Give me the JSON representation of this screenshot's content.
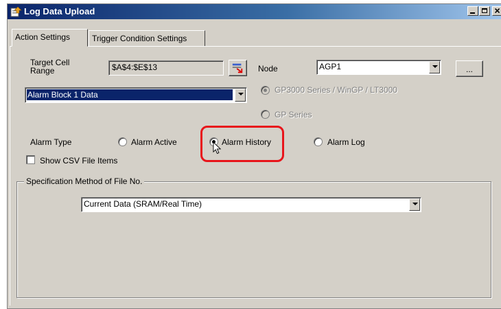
{
  "window": {
    "title": "Log Data Upload",
    "icon": "upload-icon"
  },
  "tabs": [
    {
      "label": "Action Settings",
      "active": true
    },
    {
      "label": "Trigger Condition Settings",
      "active": false
    }
  ],
  "target_cell_range": {
    "label": "Target Cell Range",
    "value": "$A$4:$E$13",
    "picker_icon": "cell-select-icon"
  },
  "node": {
    "label": "Node",
    "value": "AGP1",
    "browse_label": "..."
  },
  "data_block": {
    "value": "Alarm Block 1 Data"
  },
  "series": {
    "options": [
      {
        "label": "GP3000 Series / WinGP / LT3000",
        "selected": true,
        "enabled": false
      },
      {
        "label": "GP Series",
        "selected": false,
        "enabled": false
      }
    ]
  },
  "alarm_type": {
    "label": "Alarm Type",
    "options": [
      {
        "label": "Alarm Active",
        "selected": false
      },
      {
        "label": "Alarm History",
        "selected": true
      },
      {
        "label": "Alarm Log",
        "selected": false
      }
    ]
  },
  "show_csv": {
    "label": "Show CSV File Items",
    "checked": false
  },
  "file_no": {
    "group_label": "Specification Method of File No.",
    "value": "Current Data (SRAM/Real Time)"
  },
  "colors": {
    "highlight": "#e8151b",
    "titlebar": "#0a246a",
    "face": "#d4d0c8"
  }
}
